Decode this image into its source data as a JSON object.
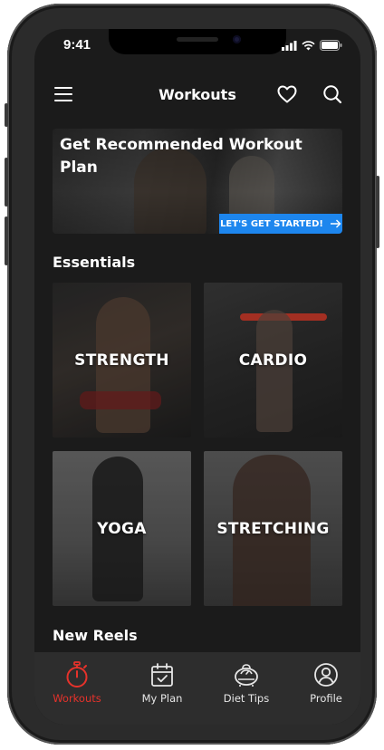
{
  "status": {
    "time": "9:41"
  },
  "header": {
    "title": "Workouts"
  },
  "banner": {
    "title": "Get Recommended Workout Plan",
    "cta": "LET'S GET STARTED!"
  },
  "sections": {
    "essentials": "Essentials",
    "new_reels": "New Reels"
  },
  "cards": [
    {
      "label": "STRENGTH"
    },
    {
      "label": "CARDIO"
    },
    {
      "label": "YOGA"
    },
    {
      "label": "STRETCHING"
    }
  ],
  "tabs": [
    {
      "label": "Workouts",
      "icon": "stopwatch-icon",
      "active": true
    },
    {
      "label": "My Plan",
      "icon": "calendar-check-icon",
      "active": false
    },
    {
      "label": "Diet Tips",
      "icon": "scale-icon",
      "active": false
    },
    {
      "label": "Profile",
      "icon": "profile-icon",
      "active": false
    }
  ],
  "colors": {
    "accent": "#e6322b",
    "cta": "#1d86ee",
    "background": "#1b1b1b",
    "tabbar": "#2d2d2d"
  }
}
